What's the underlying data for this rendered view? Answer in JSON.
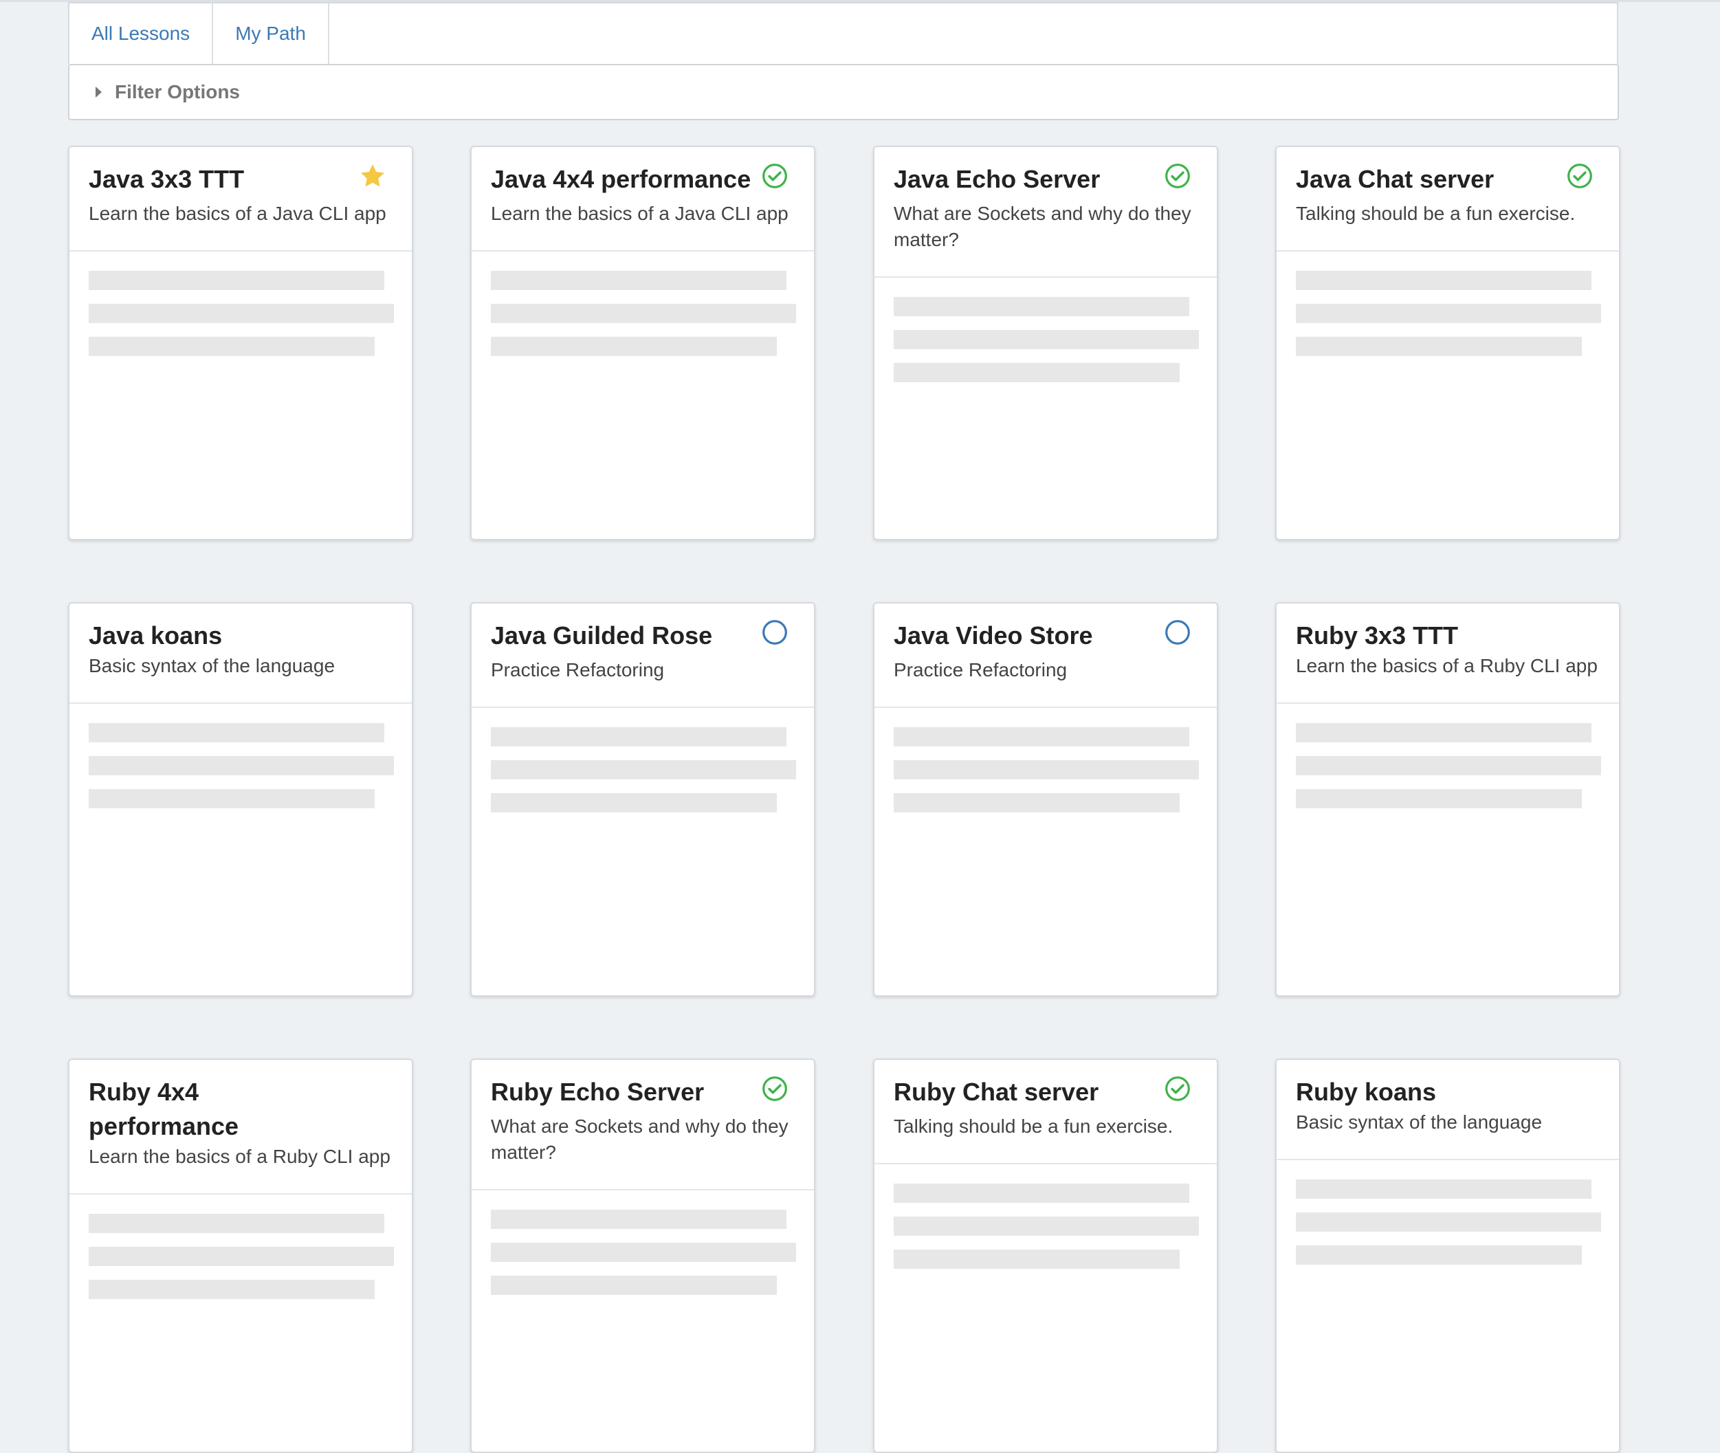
{
  "tabs": [
    {
      "label": "All Lessons"
    },
    {
      "label": "My Path"
    }
  ],
  "filter": {
    "label": "Filter Options"
  },
  "colors": {
    "complete": "#3db34a",
    "in_path": "#3b79b5",
    "favorite": "#f5c842",
    "link": "#3b79b5"
  },
  "cards": [
    {
      "title": "Java 3x3 TTT",
      "description": "Learn the basics of a Java CLI app",
      "status": "star-icon"
    },
    {
      "title": "Java 4x4 performance",
      "description": "Learn the basics of a Java CLI app",
      "status": "check-circle-icon"
    },
    {
      "title": "Java Echo Server",
      "description": "What are Sockets and why do they matter?",
      "status": "check-circle-icon"
    },
    {
      "title": "Java Chat server",
      "description": "Talking should be a fun exercise.",
      "status": "check-circle-icon"
    },
    {
      "title": "Java koans",
      "description": "Basic syntax of the language",
      "status": ""
    },
    {
      "title": "Java Guilded Rose",
      "description": "Practice Refactoring",
      "status": "empty-circle-icon"
    },
    {
      "title": "Java Video Store",
      "description": "Practice Refactoring",
      "status": "empty-circle-icon"
    },
    {
      "title": "Ruby 3x3 TTT",
      "description": "Learn the basics of a Ruby CLI app",
      "status": ""
    },
    {
      "title": "Ruby 4x4 performance",
      "description": "Learn the basics of a Ruby CLI app",
      "status": ""
    },
    {
      "title": "Ruby Echo Server",
      "description": "What are Sockets and why do they matter?",
      "status": "check-circle-icon"
    },
    {
      "title": "Ruby Chat server",
      "description": "Talking should be a fun exercise.",
      "status": "check-circle-icon"
    },
    {
      "title": "Ruby koans",
      "description": "Basic syntax of the language",
      "status": ""
    }
  ]
}
